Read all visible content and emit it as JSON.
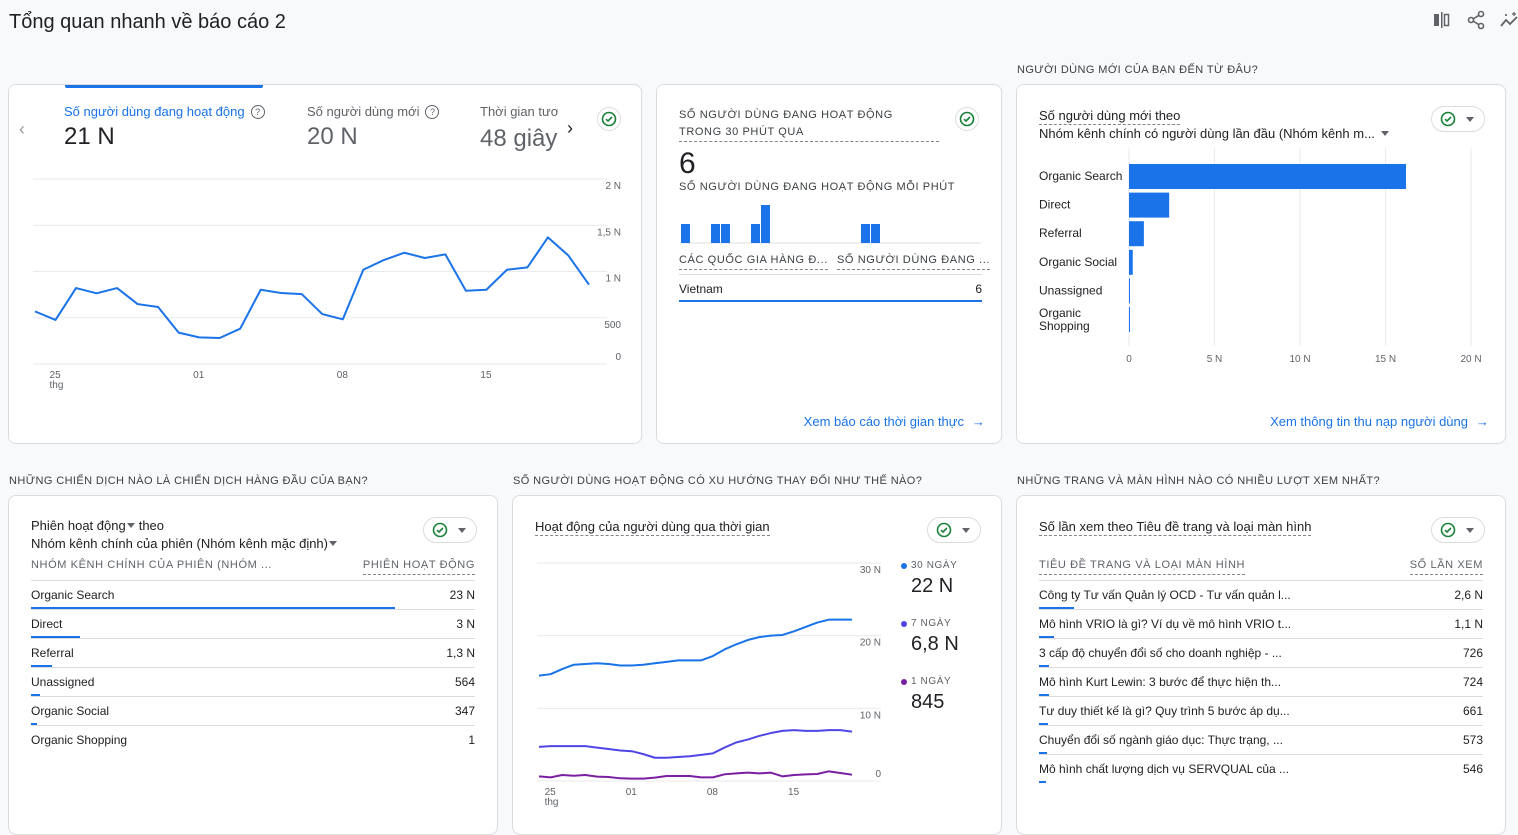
{
  "page_title": "Tổng quan nhanh về báo cáo 2",
  "toolbar": {
    "icons": [
      "compare-icon",
      "share-icon",
      "insights-icon"
    ]
  },
  "colors": {
    "accent": "#1a73e8",
    "series_30d": "#1a73e8",
    "series_7d": "#4f46e5",
    "series_1d": "#7b1fa2",
    "check": "#188038"
  },
  "card1": {
    "tabs": [
      {
        "label": "Số người dùng đang hoạt động",
        "value": "21 N",
        "active": true
      },
      {
        "label": "Số người dùng mới",
        "value": "20 N"
      },
      {
        "label": "Thời gian tươ",
        "value": "48 giây"
      }
    ],
    "chart_data": {
      "type": "line",
      "x": [
        "24",
        "25",
        "26",
        "27",
        "28",
        "29",
        "30",
        "31",
        "01",
        "02",
        "03",
        "04",
        "05",
        "06",
        "07",
        "08",
        "09",
        "10",
        "11",
        "12",
        "13",
        "14",
        "15",
        "16",
        "17",
        "18",
        "19",
        "20"
      ],
      "x_tick_labels": [
        {
          "at": "25",
          "label": "25",
          "sub": "thg"
        },
        {
          "at": "01",
          "label": "01"
        },
        {
          "at": "08",
          "label": "08"
        },
        {
          "at": "15",
          "label": "15"
        }
      ],
      "values": [
        569,
        476,
        821,
        764,
        821,
        648,
        616,
        339,
        288,
        281,
        382,
        803,
        767,
        756,
        540,
        483,
        1019,
        1124,
        1203,
        1146,
        1185,
        792,
        803,
        1019,
        1045,
        1369,
        1171,
        857
      ],
      "ylim": [
        0,
        2000
      ],
      "y_ticks": [
        {
          "v": 0,
          "label": "0"
        },
        {
          "v": 500,
          "label": "500"
        },
        {
          "v": 1000,
          "label": "1 N"
        },
        {
          "v": 1500,
          "label": "1,5 N"
        },
        {
          "v": 2000,
          "label": "2 N"
        }
      ],
      "grid": true
    }
  },
  "card2": {
    "title": "SỐ NGƯỜI DÙNG ĐANG HOẠT ĐỘNG TRONG 30 PHÚT QUA",
    "value": "6",
    "subtitle": "SỐ NGƯỜI DÙNG ĐANG HOẠT ĐỘNG MỖI PHÚT",
    "chart_data": {
      "type": "bar",
      "values": [
        1,
        0,
        0,
        1,
        1,
        0,
        0,
        1,
        2,
        0,
        0,
        0,
        0,
        0,
        0,
        0,
        0,
        0,
        1,
        1,
        0,
        0,
        0,
        0,
        0,
        0,
        0,
        0,
        0,
        0
      ]
    },
    "col1": "CÁC QUỐC GIA HÀNG Đ...",
    "col2": "SỐ NGƯỜI DÙNG ĐANG ...",
    "rows": [
      {
        "country": "Vietnam",
        "value": "6"
      }
    ],
    "link": "Xem báo cáo thời gian thực"
  },
  "card3": {
    "section": "NGƯỜI DÙNG MỚI CỦA BẠN ĐẾN TỪ ĐÂU?",
    "title": "Số người dùng mới theo",
    "dimension": "Nhóm kênh chính có người dùng lần đầu (Nhóm kênh m...",
    "chart_data": {
      "type": "bar",
      "orientation": "horizontal",
      "categories": [
        "Organic Search",
        "Direct",
        "Referral",
        "Organic Social",
        "Unassigned",
        "Organic Shopping"
      ],
      "values": [
        16200,
        2350,
        870,
        220,
        40,
        20
      ],
      "xlim": [
        0,
        20000
      ],
      "x_ticks": [
        {
          "v": 0,
          "label": "0"
        },
        {
          "v": 5000,
          "label": "5 N"
        },
        {
          "v": 10000,
          "label": "10 N"
        },
        {
          "v": 15000,
          "label": "15 N"
        },
        {
          "v": 20000,
          "label": "20 N"
        }
      ],
      "grid": true
    },
    "link": "Xem thông tin thu nạp người dùng"
  },
  "card4": {
    "section": "NHỮNG CHIẾN DỊCH NÀO LÀ CHIẾN DỊCH HÀNG ĐẦU CỦA BẠN?",
    "metric": "Phiên hoạt động",
    "theo": "theo",
    "dimension": "Nhóm kênh chính của phiên (Nhóm kênh mặc định)",
    "col1": "NHÓM KÊNH CHÍNH CỦA PHIÊN (NHÓM ...",
    "col2": "PHIÊN HOẠT ĐỘNG",
    "rows": [
      {
        "label": "Organic Search",
        "value": "23 N",
        "bar": 0.82
      },
      {
        "label": "Direct",
        "value": "3 N",
        "bar": 0.11
      },
      {
        "label": "Referral",
        "value": "1,3 N",
        "bar": 0.047
      },
      {
        "label": "Unassigned",
        "value": "564",
        "bar": 0.02
      },
      {
        "label": "Organic Social",
        "value": "347",
        "bar": 0.013
      },
      {
        "label": "Organic Shopping",
        "value": "1",
        "bar": 0
      }
    ]
  },
  "card5": {
    "section": "SỐ NGƯỜI DÙNG HOẠT ĐỘNG CÓ XU HƯỚNG THAY ĐỔI NHƯ THẾ NÀO?",
    "title": "Hoạt động của người dùng qua thời gian",
    "chart_data": {
      "type": "line",
      "x": [
        "24",
        "25",
        "26",
        "27",
        "28",
        "29",
        "30",
        "31",
        "01",
        "02",
        "03",
        "04",
        "05",
        "06",
        "07",
        "08",
        "09",
        "10",
        "11",
        "12",
        "13",
        "14",
        "15",
        "16",
        "17",
        "18",
        "19",
        "20"
      ],
      "x_tick_labels": [
        {
          "at": "25",
          "label": "25",
          "sub": "thg"
        },
        {
          "at": "01",
          "label": "01"
        },
        {
          "at": "08",
          "label": "08"
        },
        {
          "at": "15",
          "label": "15"
        }
      ],
      "ylim": [
        0,
        30000
      ],
      "y_ticks": [
        {
          "v": 0,
          "label": "0"
        },
        {
          "v": 10000,
          "label": "10 N"
        },
        {
          "v": 20000,
          "label": "20 N"
        },
        {
          "v": 30000,
          "label": "30 N"
        }
      ],
      "grid": true,
      "legend_position": "right",
      "series": [
        {
          "name": "30 NGÀY",
          "total": "22 N",
          "color": "#1a73e8",
          "values": [
            14500,
            14700,
            15400,
            16000,
            16100,
            16200,
            16100,
            15900,
            15900,
            16000,
            16200,
            16400,
            16600,
            16600,
            16600,
            17200,
            18100,
            18800,
            19400,
            19800,
            20000,
            20100,
            20600,
            21200,
            21800,
            22200,
            22200,
            22200
          ]
        },
        {
          "name": "7 NGÀY",
          "total": "6,8 N",
          "color": "#4f46e5",
          "values": [
            4700,
            4800,
            4800,
            4800,
            4800,
            4600,
            4400,
            4200,
            4100,
            3700,
            3200,
            3200,
            3300,
            3400,
            3600,
            3800,
            4600,
            5300,
            5700,
            6200,
            6600,
            6900,
            7000,
            6900,
            6900,
            7000,
            7000,
            6800
          ]
        },
        {
          "name": "1 NGÀY",
          "total": "845",
          "color": "#7b1fa2",
          "values": [
            640,
            500,
            830,
            730,
            830,
            600,
            550,
            370,
            320,
            320,
            460,
            690,
            690,
            690,
            500,
            500,
            920,
            1050,
            1150,
            1050,
            1150,
            640,
            830,
            920,
            960,
            1330,
            1100,
            870
          ]
        }
      ]
    }
  },
  "card6": {
    "section": "NHỮNG TRANG VÀ MÀN HÌNH NÀO CÓ NHIỀU LƯỢT XEM NHẤT?",
    "title": "Số lần xem theo Tiêu đề trang và loại màn hình",
    "col1": "TIÊU ĐỀ TRANG VÀ LOẠI MÀN HÌNH",
    "col2": "SỐ LẦN XEM",
    "rows": [
      {
        "label": "Công ty Tư vấn Quản lý OCD - Tư vấn quản l...",
        "value": "2,6 N",
        "bar": 0.079
      },
      {
        "label": "Mô hình VRIO là gì? Ví dụ về mô hình VRIO t...",
        "value": "1,1 N",
        "bar": 0.033
      },
      {
        "label": "3 cấp độ chuyển đổi số cho doanh nghiệp - ...",
        "value": "726",
        "bar": 0.022
      },
      {
        "label": "Mô hình Kurt Lewin: 3 bước để thực hiện th...",
        "value": "724",
        "bar": 0.022
      },
      {
        "label": "Tư duy thiết kế là gì? Quy trình 5 bước áp dụ...",
        "value": "661",
        "bar": 0.02
      },
      {
        "label": "Chuyển đổi số ngành giáo dục: Thực trạng, ...",
        "value": "573",
        "bar": 0.017
      },
      {
        "label": "Mô hình chất lượng dịch vụ SERVQUAL của ...",
        "value": "546",
        "bar": 0.016
      }
    ]
  }
}
